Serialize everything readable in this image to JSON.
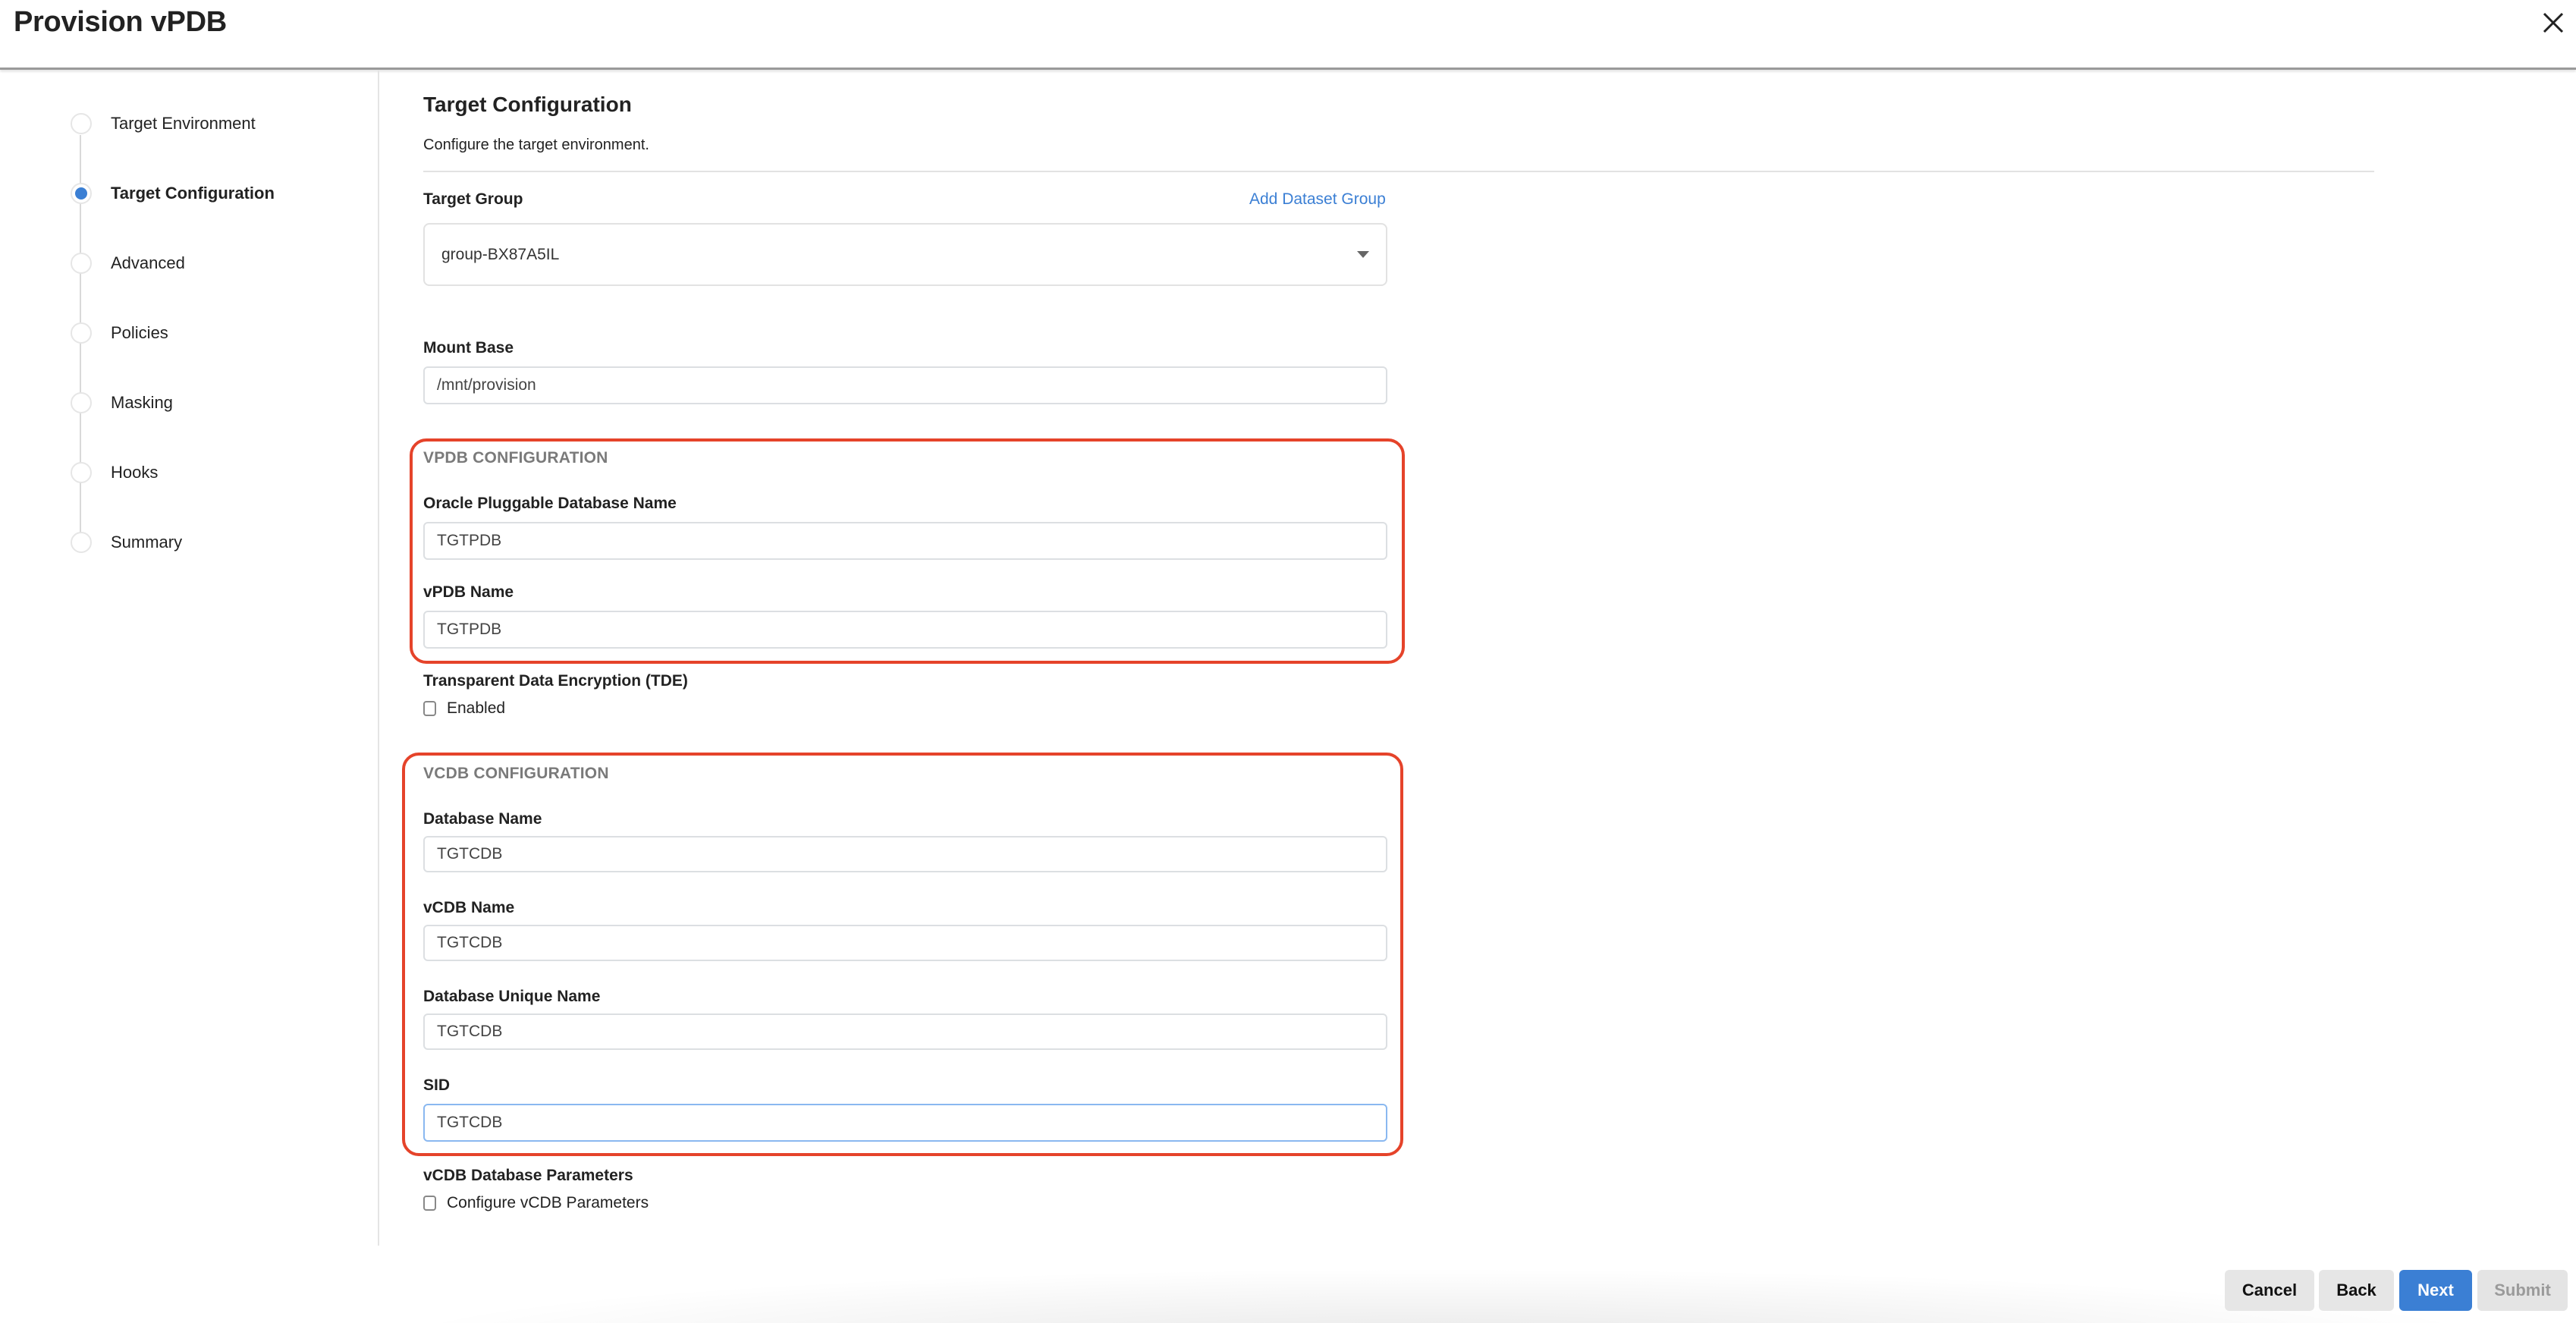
{
  "window": {
    "title": "Provision vPDB",
    "close_icon": "close-icon"
  },
  "colors": {
    "accent": "#3b7fd4",
    "highlight_box": "#e5432a"
  },
  "stepper": {
    "steps": [
      {
        "label": "Target Environment",
        "active": false
      },
      {
        "label": "Target Configuration",
        "active": true
      },
      {
        "label": "Advanced",
        "active": false
      },
      {
        "label": "Policies",
        "active": false
      },
      {
        "label": "Masking",
        "active": false
      },
      {
        "label": "Hooks",
        "active": false
      },
      {
        "label": "Summary",
        "active": false
      }
    ]
  },
  "main": {
    "heading": "Target Configuration",
    "description": "Configure the target environment.",
    "target_group": {
      "label": "Target Group",
      "add_link": "Add Dataset Group",
      "selected": "group-BX87A5IL"
    },
    "mount_base": {
      "label": "Mount Base",
      "value": "/mnt/provision"
    },
    "vpdb_section": {
      "heading": "VPDB CONFIGURATION",
      "fields": [
        {
          "label": "Oracle Pluggable Database Name",
          "value": "TGTPDB"
        },
        {
          "label": "vPDB Name",
          "value": "TGTPDB"
        }
      ]
    },
    "tde": {
      "label": "Transparent Data Encryption (TDE)",
      "checkbox_label": "Enabled",
      "checked": false
    },
    "vcdb_section": {
      "heading": "VCDB CONFIGURATION",
      "fields": [
        {
          "label": "Database Name",
          "value": "TGTCDB"
        },
        {
          "label": "vCDB Name",
          "value": "TGTCDB"
        },
        {
          "label": "Database Unique Name",
          "value": "TGTCDB"
        },
        {
          "label": "SID",
          "value": "TGTCDB"
        }
      ]
    },
    "vcdb_params": {
      "label": "vCDB Database Parameters",
      "checkbox_label": "Configure vCDB Parameters",
      "checked": false
    }
  },
  "footer": {
    "cancel": "Cancel",
    "back": "Back",
    "next": "Next",
    "submit": "Submit"
  }
}
